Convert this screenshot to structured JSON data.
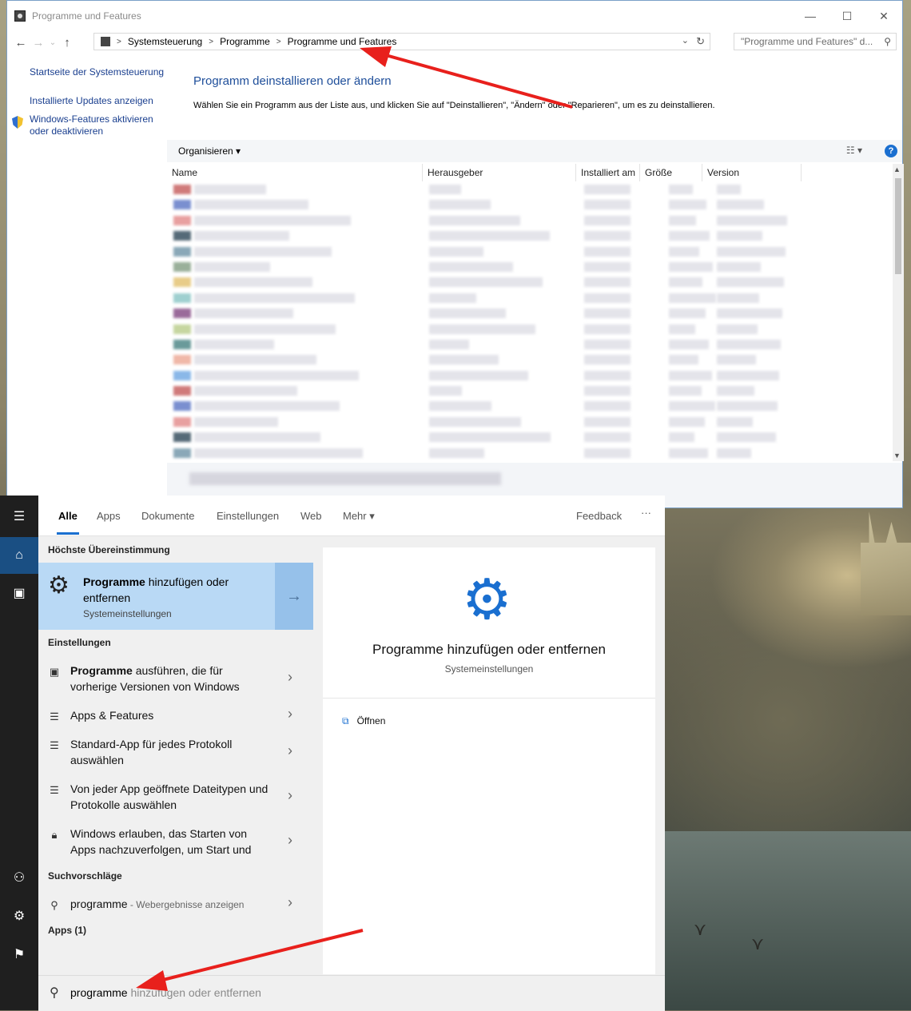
{
  "window": {
    "title": "Programme und Features",
    "controls": {
      "minimize": "—",
      "maximize": "☐",
      "close": "✕"
    },
    "breadcrumb": [
      "Systemsteuerung",
      "Programme",
      "Programme und Features"
    ],
    "search_placeholder": "\"Programme und Features\" d...",
    "left_links": [
      "Startseite der Systemsteuerung",
      "Installierte Updates anzeigen",
      "Windows-Features aktivieren oder deaktivieren"
    ],
    "heading": "Programm deinstallieren oder ändern",
    "description": "Wählen Sie ein Programm aus der Liste aus, und klicken Sie auf \"Deinstallieren\", \"Ändern\" oder \"Reparieren\", um es zu deinstallieren.",
    "toolbar": {
      "organize": "Organisieren",
      "help": "?"
    },
    "columns": [
      "Name",
      "Herausgeber",
      "Installiert am",
      "Größe",
      "Version"
    ],
    "row_count": 18
  },
  "start": {
    "tabs": [
      "Alle",
      "Apps",
      "Dokumente",
      "Einstellungen",
      "Web",
      "Mehr"
    ],
    "feedback": "Feedback",
    "more_dots": "···",
    "best_match_header": "Höchste Übereinstimmung",
    "best_match": {
      "title_bold": "Programme",
      "title_rest": " hinzufügen oder entfernen",
      "subtitle": "Systemeinstellungen"
    },
    "settings_header": "Einstellungen",
    "settings_items": [
      {
        "bold": "Programme",
        "rest": " ausführen, die für vorherige Versionen von Windows",
        "icon": "compat-icon"
      },
      {
        "bold": "",
        "rest": "Apps & Features",
        "icon": "list-icon"
      },
      {
        "bold": "",
        "rest": "Standard-App für jedes Protokoll auswählen",
        "icon": "list-icon"
      },
      {
        "bold": "",
        "rest": "Von jeder App geöffnete Dateitypen und Protokolle auswählen",
        "icon": "list-icon"
      },
      {
        "bold": "",
        "rest": "Windows erlauben, das Starten von Apps nachzuverfolgen, um Start und",
        "icon": "lock-icon"
      }
    ],
    "suggest_header": "Suchvorschläge",
    "suggestion": {
      "term": "programme",
      "hint": " - Webergebnisse anzeigen"
    },
    "apps_header": "Apps (1)",
    "preview": {
      "title": "Programme hinzufügen oder entfernen",
      "subtitle": "Systemeinstellungen",
      "open": "Öffnen"
    },
    "search": {
      "typed": "programme",
      "completion": " hinzufügen oder entfernen"
    }
  },
  "colors": {
    "accent": "#1a6fd0",
    "best_match_bg": "#b9d9f5",
    "arrow": "#e8201c",
    "heading": "#1e4e9a"
  }
}
